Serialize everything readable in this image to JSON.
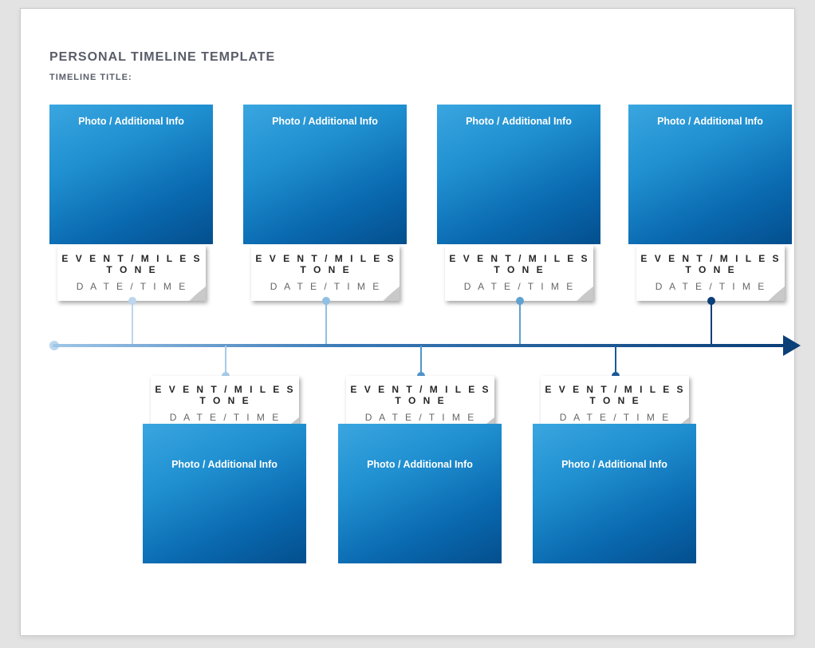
{
  "header": {
    "mainTitle": "PERSONAL TIMELINE TEMPLATE",
    "subTitle": "TIMELINE TITLE:"
  },
  "labels": {
    "photoInfo": "Photo / Additional Info",
    "eventMilestone": "E V E N T   /   M I L E S T O N E",
    "dateTime": "D A T E   /   T I M E"
  },
  "topEvents": [
    {
      "photo": "Photo / Additional Info",
      "event": "E V E N T   /   M I L E S T O N E",
      "date": "D A T E   /   T I M E"
    },
    {
      "photo": "Photo / Additional Info",
      "event": "E V E N T   /   M I L E S T O N E",
      "date": "D A T E   /   T I M E"
    },
    {
      "photo": "Photo / Additional Info",
      "event": "E V E N T   /   M I L E S T O N E",
      "date": "D A T E   /   T I M E"
    },
    {
      "photo": "Photo / Additional Info",
      "event": "E V E N T   /   M I L E S T O N E",
      "date": "D A T E   /   T I M E"
    }
  ],
  "bottomEvents": [
    {
      "photo": "Photo / Additional Info",
      "event": "E V E N T   /   M I L E S T O N E",
      "date": "D A T E   /   T I M E"
    },
    {
      "photo": "Photo / Additional Info",
      "event": "E V E N T   /   M I L E S T O N E",
      "date": "D A T E   /   T I M E"
    },
    {
      "photo": "Photo / Additional Info",
      "event": "E V E N T   /   M I L E S T O N E",
      "date": "D A T E   /   T I M E"
    }
  ]
}
